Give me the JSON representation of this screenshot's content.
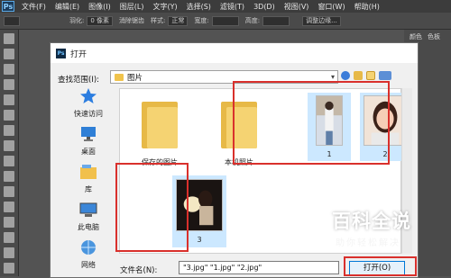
{
  "ps": {
    "logo": "Ps",
    "menu": [
      "文件(F)",
      "编辑(E)",
      "图像(I)",
      "图层(L)",
      "文字(Y)",
      "选择(S)",
      "滤镜(T)",
      "3D(D)",
      "视图(V)",
      "窗口(W)",
      "帮助(H)"
    ],
    "options": {
      "feather_label": "羽化:",
      "feather_value": "0 像素",
      "antialias_label": "消除锯齿",
      "style_label": "样式:",
      "style_value": "正常",
      "width_label": "宽度:",
      "height_label": "高度:",
      "refine_button": "调整边缘..."
    },
    "panel_tabs": [
      "颜色",
      "色板"
    ]
  },
  "dialog": {
    "title": "打开",
    "look_in_label": "查找范围(I):",
    "look_in_value": "图片",
    "sidebar": [
      {
        "label": "快速访问",
        "icon": "star-icon"
      },
      {
        "label": "桌面",
        "icon": "desktop-icon"
      },
      {
        "label": "库",
        "icon": "library-icon"
      },
      {
        "label": "此电脑",
        "icon": "computer-icon"
      },
      {
        "label": "网络",
        "icon": "network-icon"
      }
    ],
    "files": [
      {
        "name": "保存的图片",
        "type": "folder"
      },
      {
        "name": "本机照片",
        "type": "folder"
      },
      {
        "name": "1",
        "type": "image"
      },
      {
        "name": "2",
        "type": "image"
      },
      {
        "name": "3",
        "type": "image"
      }
    ],
    "filename_label": "文件名(N):",
    "filename_value": "\"3.jpg\" \"1.jpg\" \"2.jpg\"",
    "open_button": "打开(O)",
    "colors": {
      "highlight": "#d9302c",
      "selection": "#cce8ff",
      "accent": "#0078d7"
    }
  },
  "watermark": {
    "title": "百科全说",
    "subtitle": "助你轻松解决"
  }
}
